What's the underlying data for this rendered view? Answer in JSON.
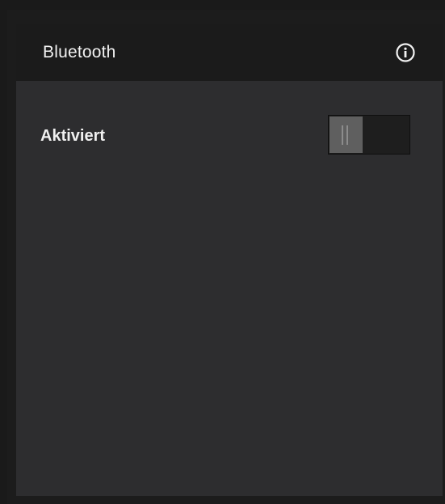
{
  "panel": {
    "title": "Bluetooth",
    "info_icon": "info-icon"
  },
  "settings": {
    "enabled_label": "Aktiviert",
    "enabled_value": false
  },
  "colors": {
    "header_bg": "#1b1b1b",
    "panel_bg": "#2d2d2f",
    "text": "#f0f0f0"
  }
}
